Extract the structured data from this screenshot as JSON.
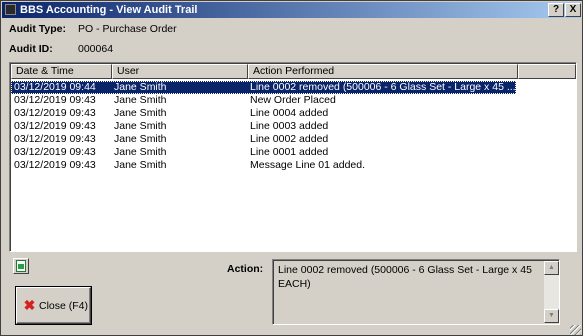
{
  "window": {
    "title": "BBS Accounting - View Audit Trail",
    "help_button": "?",
    "close_button": "X"
  },
  "audit": {
    "type_label": "Audit Type:",
    "type_value": "PO - Purchase Order",
    "id_label": "Audit ID:",
    "id_value": "000064"
  },
  "table": {
    "columns": [
      "Date & Time",
      "User",
      "Action Performed"
    ],
    "rows": [
      {
        "date": "03/12/2019 09:44",
        "user": "Jane Smith",
        "action": "Line 0002 removed (500006 - 6 Glass Set - Large x 45 ...",
        "selected": true
      },
      {
        "date": "03/12/2019 09:43",
        "user": "Jane Smith",
        "action": "New Order Placed",
        "selected": false
      },
      {
        "date": "03/12/2019 09:43",
        "user": "Jane Smith",
        "action": "Line 0004 added",
        "selected": false
      },
      {
        "date": "03/12/2019 09:43",
        "user": "Jane Smith",
        "action": "Line 0003 added",
        "selected": false
      },
      {
        "date": "03/12/2019 09:43",
        "user": "Jane Smith",
        "action": "Line 0002 added",
        "selected": false
      },
      {
        "date": "03/12/2019 09:43",
        "user": "Jane Smith",
        "action": "Line 0001 added",
        "selected": false
      },
      {
        "date": "03/12/2019 09:43",
        "user": "Jane Smith",
        "action": "Message Line 01 added.",
        "selected": false
      }
    ]
  },
  "action_detail": {
    "label": "Action:",
    "text": "Line 0002 removed (500006 - 6 Glass Set - Large x 45 EACH)"
  },
  "buttons": {
    "close_label": "Close (F4)",
    "export_icon": "excel-export-icon"
  },
  "colors": {
    "selection": "#0a246a",
    "titlebar_start": "#0a246a",
    "titlebar_end": "#a6caf0",
    "face": "#d4d0c8"
  }
}
